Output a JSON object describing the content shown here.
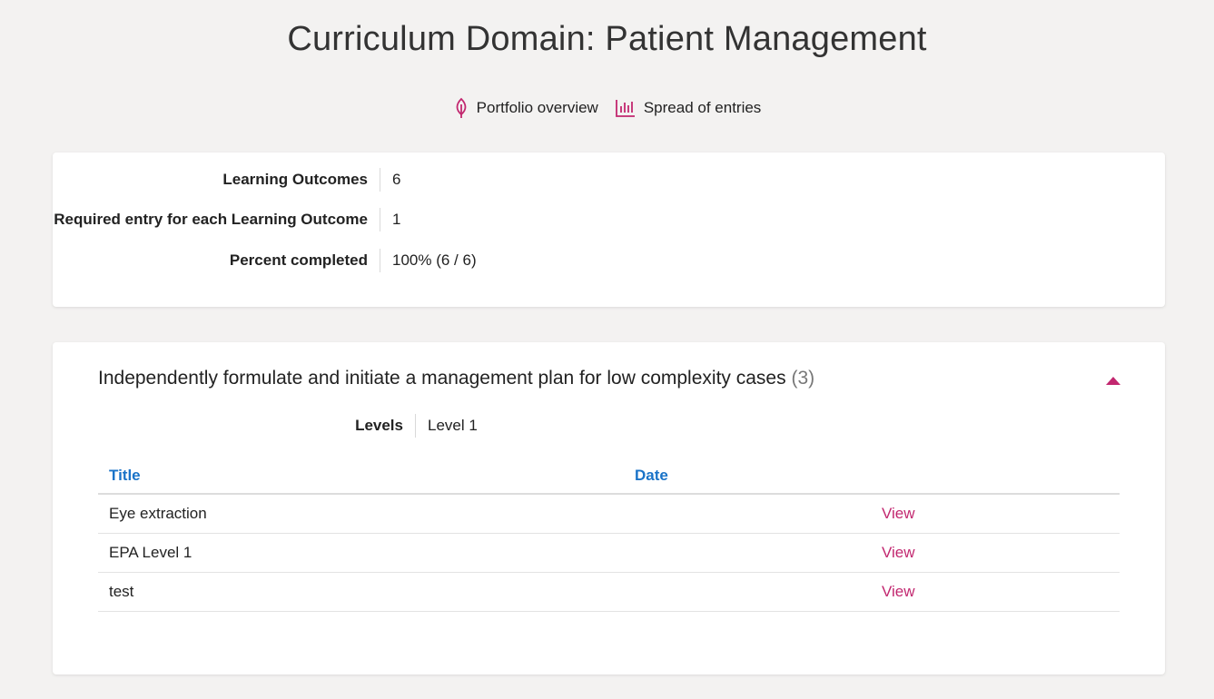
{
  "page": {
    "title": "Curriculum Domain: Patient Management"
  },
  "subnav": {
    "portfolio_overview": "Portfolio overview",
    "spread_of_entries": "Spread of entries",
    "icon_color": "#c2276f"
  },
  "summary": {
    "rows": [
      {
        "label": "Learning Outcomes",
        "value": "6"
      },
      {
        "label": "Required entry for each Learning Outcome",
        "value": "1"
      },
      {
        "label": "Percent completed",
        "value": "100% (6 / 6)"
      }
    ]
  },
  "outcome": {
    "title": "Independently formulate and initiate a management plan for low complexity cases",
    "count": "(3)",
    "levels_label": "Levels",
    "levels_value": "Level 1",
    "table": {
      "headers": {
        "title": "Title",
        "date": "Date"
      },
      "rows": [
        {
          "title": "Eye extraction",
          "date": "",
          "action": "View"
        },
        {
          "title": "EPA Level 1",
          "date": "",
          "action": "View"
        },
        {
          "title": "test",
          "date": "",
          "action": "View"
        }
      ]
    }
  },
  "colors": {
    "accent": "#c2276f",
    "link_blue": "#1a73c8",
    "background": "#f3f2f1"
  }
}
